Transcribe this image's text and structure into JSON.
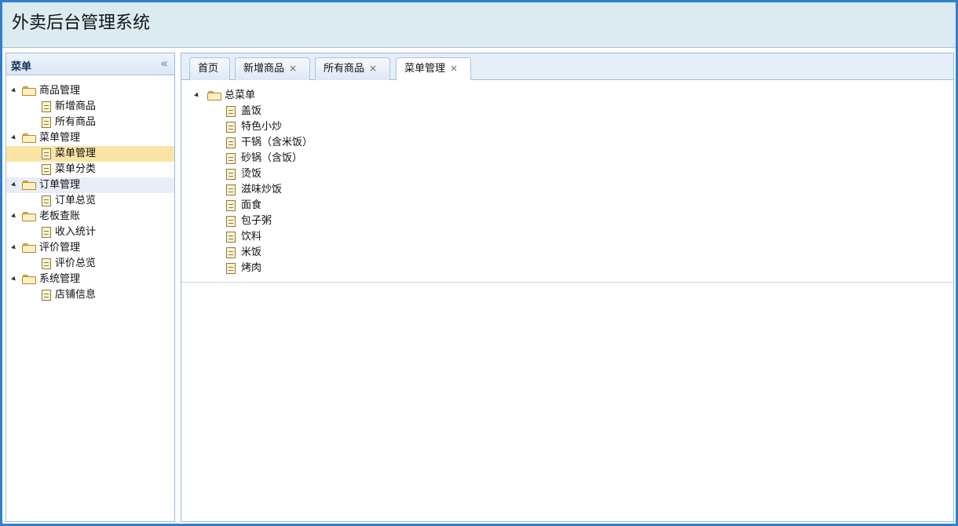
{
  "app": {
    "title": "外卖后台管理系统"
  },
  "sidebar": {
    "title": "菜单",
    "collapse_icon": "double-chevron-left-icon",
    "groups": [
      {
        "label": "商品管理",
        "items": [
          "新增商品",
          "所有商品"
        ]
      },
      {
        "label": "菜单管理",
        "items": [
          "菜单管理",
          "菜单分类"
        ]
      },
      {
        "label": "订单管理",
        "items": [
          "订单总览"
        ]
      },
      {
        "label": "老板查账",
        "items": [
          "收入统计"
        ]
      },
      {
        "label": "评价管理",
        "items": [
          "评价总览"
        ]
      },
      {
        "label": "系统管理",
        "items": [
          "店铺信息"
        ]
      }
    ],
    "selected": "菜单管理"
  },
  "tabs": [
    {
      "label": "首页",
      "closable": false
    },
    {
      "label": "新增商品",
      "closable": true
    },
    {
      "label": "所有商品",
      "closable": true
    },
    {
      "label": "菜单管理",
      "closable": true,
      "active": true
    }
  ],
  "tab_close_glyph": "×",
  "menu_tree": {
    "root": "总菜单",
    "items": [
      "盖饭",
      "特色小炒",
      "干锅（含米饭）",
      "砂锅（含饭）",
      "烫饭",
      "滋味炒饭",
      "面食",
      "包子粥",
      "饮料",
      "米饭",
      "烤肉"
    ]
  },
  "colors": {
    "header_bg": "#dcebf0",
    "selected_bg": "#fbe4a6",
    "border_blue": "#2f7fd4"
  }
}
